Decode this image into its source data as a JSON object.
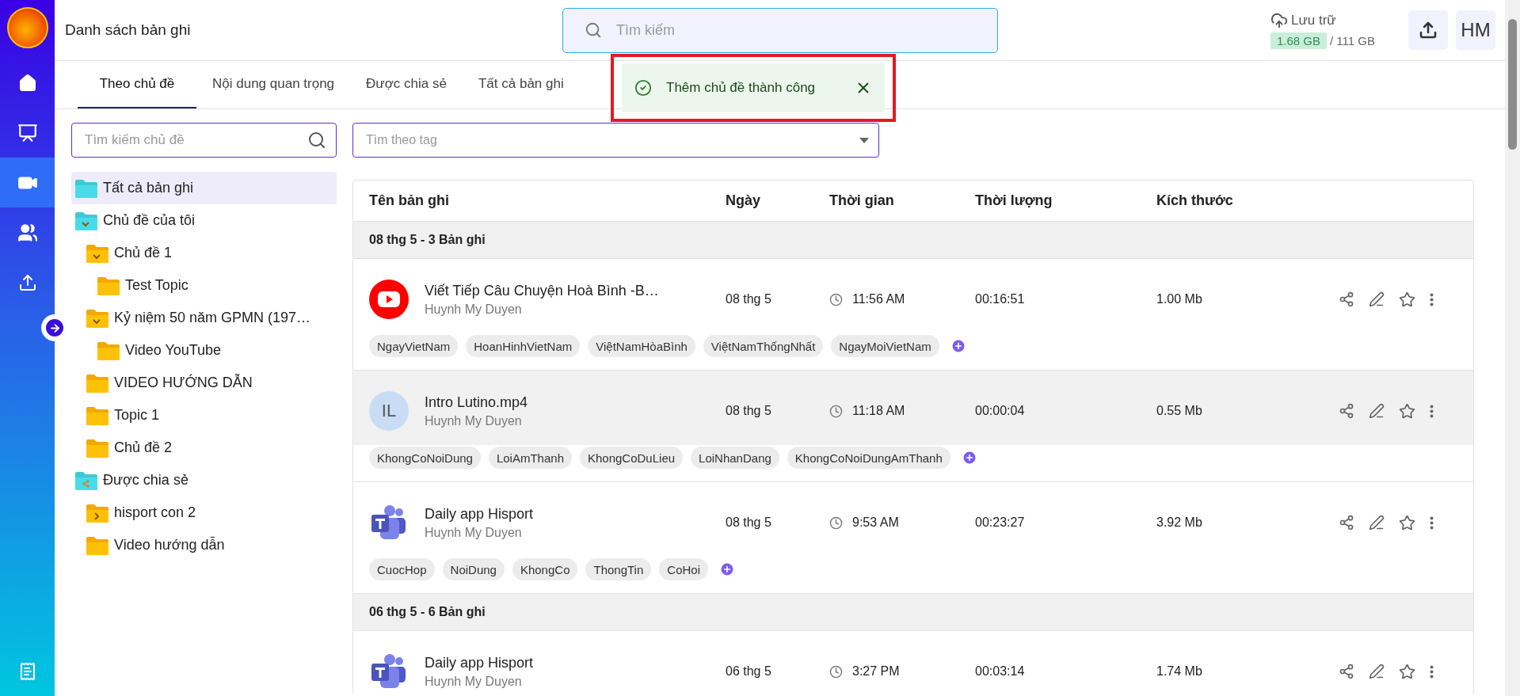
{
  "nav": {
    "items": [
      {
        "kind": "home",
        "selected": false
      },
      {
        "kind": "meeting",
        "selected": false
      },
      {
        "kind": "video",
        "selected": true
      },
      {
        "kind": "people",
        "selected": false
      },
      {
        "kind": "upload",
        "selected": false
      }
    ],
    "footer": {
      "kind": "bill",
      "selected": false
    }
  },
  "header": {
    "title": "Danh sách bản ghi",
    "search": {
      "placeholder": "Tìm kiếm"
    },
    "storage": {
      "label": "Lưu trữ",
      "used": "1.68 GB",
      "total": "/ 111 GB"
    },
    "avatar": "HM"
  },
  "tabs": [
    {
      "label": "Theo chủ đề",
      "selected": true
    },
    {
      "label": "Nội dung quan trọng",
      "selected": false
    },
    {
      "label": "Được chia sẻ",
      "selected": false
    },
    {
      "label": "Tất cả bản ghi",
      "selected": false
    }
  ],
  "toast": {
    "text": "Thêm chủ đề thành công",
    "highlighted": true
  },
  "topic_search": {
    "placeholder": "Tìm kiếm chủ đề"
  },
  "tag_filter": {
    "placeholder": "Tìm theo tag"
  },
  "tree": [
    {
      "label": "Tất cả bản ghi",
      "kind": "all",
      "selected": true
    },
    {
      "label": "Chủ đề của tôi",
      "kind": "mine",
      "selected": false,
      "expanded": true,
      "children": [
        {
          "label": "Chủ đề 1",
          "kind": "topic",
          "selected": false,
          "expanded": true,
          "children": [
            {
              "label": "Test Topic",
              "kind": "topic",
              "selected": false
            }
          ]
        },
        {
          "label": "Kỷ niệm 50 năm GPMN (197…",
          "kind": "topic",
          "selected": false,
          "expanded": true,
          "children": [
            {
              "label": "Video YouTube",
              "kind": "topic",
              "selected": false
            }
          ]
        },
        {
          "label": "VIDEO HƯỚNG DẪN",
          "kind": "topic",
          "selected": false
        },
        {
          "label": "Topic 1",
          "kind": "topic",
          "selected": false
        },
        {
          "label": "Chủ đề 2",
          "kind": "topic",
          "selected": false
        }
      ]
    },
    {
      "label": "Được chia sẻ",
      "kind": "shared",
      "selected": false,
      "expanded": true,
      "children": [
        {
          "label": "hisport con 2",
          "kind": "topic",
          "selected": false,
          "expanded": false
        },
        {
          "label": "Video hướng dẫn",
          "kind": "topic",
          "selected": false
        }
      ]
    }
  ],
  "table": {
    "columns": [
      "Tên bản ghi",
      "Ngày",
      "Thời gian",
      "Thời lượng",
      "Kích thước"
    ],
    "groups": [
      {
        "label": "08 thg 5 - 3 Bản ghi",
        "recordings": [
          {
            "kind": "youtube",
            "title": "Viết Tiếp Câu Chuyện Hoà Bình -B…",
            "owner": "Huynh My Duyen",
            "date": "08 thg 5",
            "time": "11:56 AM",
            "duration": "00:16:51",
            "size": "1.00 Mb",
            "hovered": false,
            "tags": [
              "NgayVietNam",
              "HoanHinhVietNam",
              "ViệtNamHòaBình",
              "ViệtNamThốngNhất",
              "NgayMoiVietNam"
            ]
          },
          {
            "kind": "initials",
            "initials": "IL",
            "title": "Intro Lutino.mp4",
            "owner": "Huynh My Duyen",
            "date": "08 thg 5",
            "time": "11:18 AM",
            "duration": "00:00:04",
            "size": "0.55 Mb",
            "hovered": true,
            "tags": [
              "KhongCoNoiDung",
              "LoiAmThanh",
              "KhongCoDuLieu",
              "LoiNhanDang",
              "KhongCoNoiDungAmThanh"
            ]
          },
          {
            "kind": "teams",
            "title": "Daily app Hisport",
            "owner": "Huynh My Duyen",
            "date": "08 thg 5",
            "time": "9:53 AM",
            "duration": "00:23:27",
            "size": "3.92 Mb",
            "hovered": false,
            "tags": [
              "CuocHop",
              "NoiDung",
              "KhongCo",
              "ThongTin",
              "CoHoi"
            ]
          }
        ]
      },
      {
        "label": "06 thg 5 - 6 Bản ghi",
        "recordings": [
          {
            "kind": "teams",
            "title": "Daily app Hisport",
            "owner": "Huynh My Duyen",
            "date": "06 thg 5",
            "time": "3:27 PM",
            "duration": "00:03:14",
            "size": "1.74 Mb",
            "hovered": false
          }
        ]
      }
    ]
  }
}
